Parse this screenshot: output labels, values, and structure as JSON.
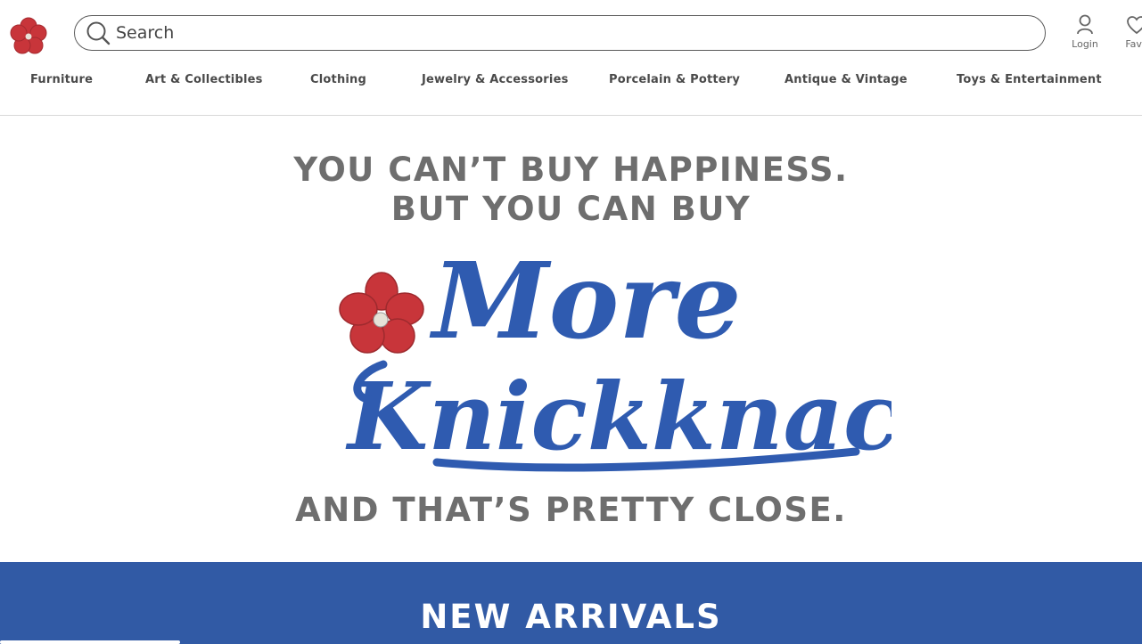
{
  "header": {
    "search": {
      "placeholder": "Search"
    },
    "login_label": "Login",
    "favorites_label": "Favo"
  },
  "nav": {
    "items": [
      "Furniture",
      "Art & Collectibles",
      "Clothing",
      "Jewelry & Accessories",
      "Porcelain & Pottery",
      "Antique & Vintage",
      "Toys & Entertainment"
    ]
  },
  "hero": {
    "line1": "YOU CAN’T BUY HAPPINESS.",
    "line2": "BUT YOU CAN BUY",
    "script_top": "More",
    "script_bottom": "Knickknacks",
    "line3": "AND THAT’S PRETTY CLOSE."
  },
  "band": {
    "title": "NEW ARRIVALS"
  },
  "colors": {
    "brand_blue": "#315aa5",
    "script_blue": "#2f5bb0",
    "flower_red": "#c8353a",
    "text_gray": "#6e6e6e"
  },
  "icons": {
    "logo": "flower-icon",
    "search": "search-icon",
    "login": "user-icon",
    "favorites": "heart-icon"
  }
}
